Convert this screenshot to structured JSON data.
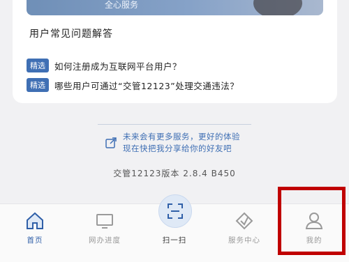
{
  "banner": {
    "text": "全心服务"
  },
  "faq": {
    "title": "用户常见问题解答",
    "items": [
      {
        "tag": "精选",
        "text": "如何注册成为互联网平台用户？"
      },
      {
        "tag": "精选",
        "text": "哪些用户可通过“交管12123”处理交通违法？"
      }
    ]
  },
  "promo": {
    "line1": "未来会有更多服务，更好的体验",
    "line2": "现在快把我分享给你的好友吧"
  },
  "version": "交管12123版本 2.8.4 B450",
  "tabs": [
    {
      "label": "首页",
      "icon": "home-icon",
      "active": true
    },
    {
      "label": "网办进度",
      "icon": "monitor-icon",
      "active": false
    },
    {
      "label": "扫一扫",
      "icon": "scan-icon",
      "active": false
    },
    {
      "label": "服务中心",
      "icon": "service-diamond-icon",
      "active": false
    },
    {
      "label": "我的",
      "icon": "user-icon",
      "active": false
    }
  ],
  "colors": {
    "accent": "#3f6fb4",
    "highlight": "#c00000"
  }
}
